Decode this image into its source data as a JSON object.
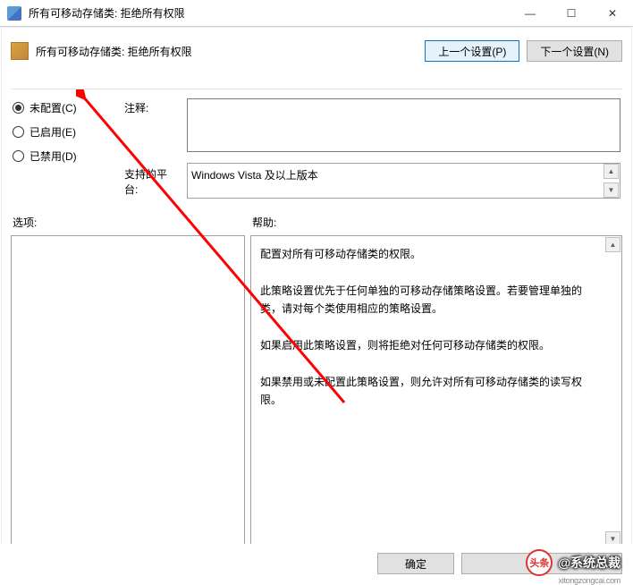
{
  "titlebar": {
    "title": "所有可移动存储类: 拒绝所有权限"
  },
  "toolbar": {
    "title": "所有可移动存储类: 拒绝所有权限",
    "prev_label": "上一个设置(P)",
    "next_label": "下一个设置(N)"
  },
  "radios": {
    "not_configured": "未配置(C)",
    "enabled": "已启用(E)",
    "disabled": "已禁用(D)"
  },
  "comment": {
    "label": "注释:",
    "value": ""
  },
  "platform": {
    "label": "支持的平台:",
    "value": "Windows Vista 及以上版本"
  },
  "labels": {
    "options": "选项:",
    "help": "帮助:"
  },
  "help_text": "配置对所有可移动存储类的权限。\n\n此策略设置优先于任何单独的可移动存储策略设置。若要管理单独的类，请对每个类使用相应的策略设置。\n\n如果启用此策略设置，则将拒绝对任何可移动存储类的权限。\n\n如果禁用或未配置此策略设置，则允许对所有可移动存储类的读写权限。",
  "footer": {
    "ok": "确定",
    "cancel": "",
    "apply": ""
  },
  "watermark": {
    "brand": "头条",
    "author": "@系统总裁",
    "url": "xitongzongcai.com"
  }
}
